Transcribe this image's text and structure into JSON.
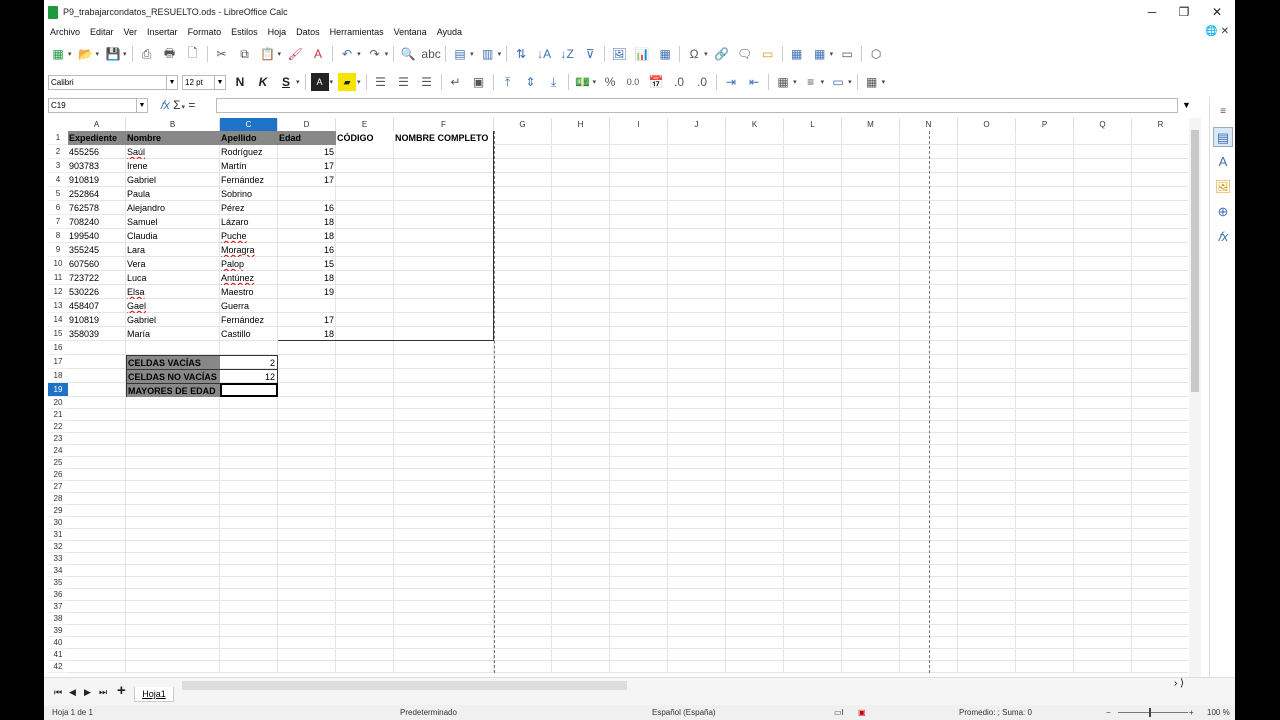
{
  "window": {
    "title": "P9_trabajarcondatos_RESUELTO.ods - LibreOffice Calc",
    "minimize": "─",
    "restore": "❐",
    "close": "✕"
  },
  "menu": [
    "Archivo",
    "Editar",
    "Ver",
    "Insertar",
    "Formato",
    "Estilos",
    "Hoja",
    "Datos",
    "Herramientas",
    "Ventana",
    "Ayuda"
  ],
  "toolbar": {
    "font_name": "Calibri",
    "font_size": "12 pt",
    "bold": "N",
    "italic": "K",
    "underline": "S",
    "percent": "%",
    "decimal": "0.0"
  },
  "formula_bar": {
    "name_box": "C19",
    "input_value": ""
  },
  "columns": [
    {
      "label": "A"
    },
    {
      "label": "B"
    },
    {
      "label": "C",
      "selected": true
    },
    {
      "label": "D"
    },
    {
      "label": "E"
    },
    {
      "label": "F"
    },
    {
      "label": "G"
    },
    {
      "label": "H"
    },
    {
      "label": "I"
    },
    {
      "label": "J"
    },
    {
      "label": "K"
    },
    {
      "label": "L"
    },
    {
      "label": "M"
    },
    {
      "label": "N"
    },
    {
      "label": "O"
    },
    {
      "label": "P"
    },
    {
      "label": "Q"
    },
    {
      "label": "R"
    }
  ],
  "rows": [
    "1",
    "2",
    "3",
    "4",
    "5",
    "6",
    "7",
    "8",
    "9",
    "10",
    "11",
    "12",
    "13",
    "14",
    "15",
    "16",
    "17",
    "18",
    "19",
    "20",
    "21",
    "22",
    "23",
    "24",
    "25",
    "26",
    "27",
    "28",
    "29",
    "30",
    "31",
    "32",
    "33",
    "34",
    "35",
    "36",
    "37",
    "38",
    "39",
    "40",
    "41",
    "42"
  ],
  "selected_row": "19",
  "table": {
    "headers": [
      "Expediente",
      "Nombre",
      "Apellido",
      "Edad",
      "CÓDIGO",
      "NOMBRE COMPLETO"
    ],
    "records": [
      {
        "expediente": "455256",
        "nombre": "Saúl",
        "apellido": "Rodríguez",
        "edad": "15"
      },
      {
        "expediente": "903783",
        "nombre": "Irene",
        "apellido": "Martín",
        "edad": "17"
      },
      {
        "expediente": "910819",
        "nombre": "Gabriel",
        "apellido": "Fernández",
        "edad": "17"
      },
      {
        "expediente": "252864",
        "nombre": "Paula",
        "apellido": "Sobrino",
        "edad": ""
      },
      {
        "expediente": "762578",
        "nombre": "Alejandro",
        "apellido": "Pérez",
        "edad": "16"
      },
      {
        "expediente": "708240",
        "nombre": "Samuel",
        "apellido": "Lázaro",
        "edad": "18"
      },
      {
        "expediente": "199540",
        "nombre": "Claudia",
        "apellido": "Puche",
        "edad": "18"
      },
      {
        "expediente": "355245",
        "nombre": "Lara",
        "apellido": "Moragra",
        "edad": "16"
      },
      {
        "expediente": "607560",
        "nombre": "Vera",
        "apellido": "Palop",
        "edad": "15"
      },
      {
        "expediente": "723722",
        "nombre": "Luca",
        "apellido": "Antúnez",
        "edad": "18"
      },
      {
        "expediente": "530226",
        "nombre": "Elsa",
        "apellido": "Maestro",
        "edad": "19"
      },
      {
        "expediente": "458407",
        "nombre": "Gael",
        "apellido": "Guerra",
        "edad": ""
      },
      {
        "expediente": "910819",
        "nombre": "Gabriel",
        "apellido": "Fernández",
        "edad": "17"
      },
      {
        "expediente": "358039",
        "nombre": "María",
        "apellido": "Castillo",
        "edad": "18"
      }
    ]
  },
  "summary": [
    {
      "label": "CELDAS VACÍAS",
      "value": "2"
    },
    {
      "label": "CELDAS NO VACÍAS",
      "value": "12"
    },
    {
      "label": "MAYORES DE EDAD",
      "value": ""
    }
  ],
  "tabs": {
    "sheet_name": "Hoja1",
    "add": "+"
  },
  "status": {
    "sheet": "Hoja 1 de 1",
    "style": "Predeterminado",
    "language": "Español (España)",
    "summary": "Promedio: ; Suma: 0",
    "zoom": "100 %"
  }
}
